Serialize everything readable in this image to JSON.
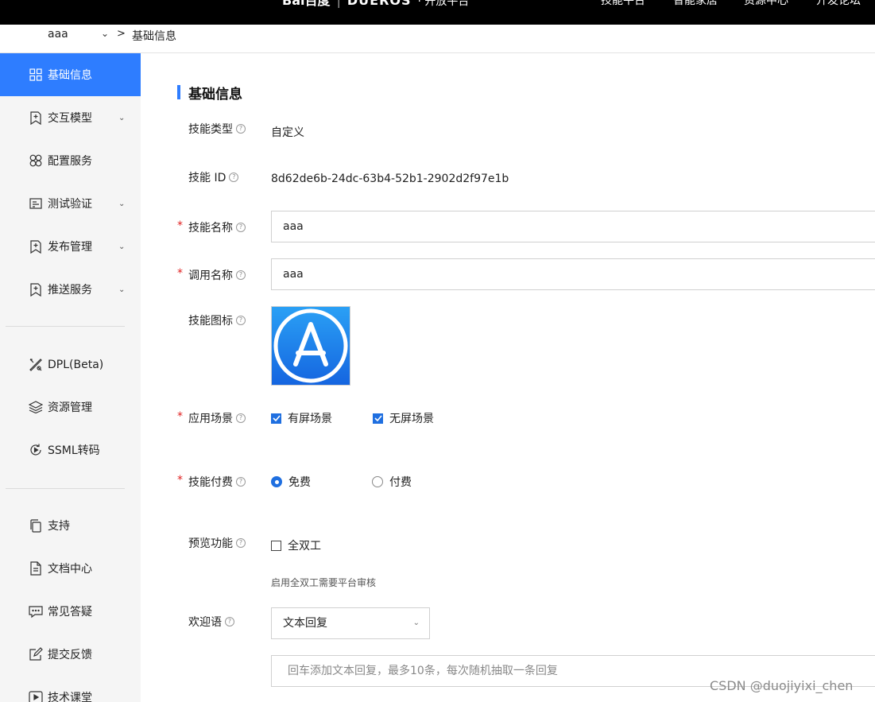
{
  "topbar": {
    "brand_logo": "Bai百度",
    "brand_os": "DUEROS",
    "brand_suffix": "· 开放平台",
    "nav": [
      "技能平台",
      "智能家居",
      "资源中心",
      "开发论坛"
    ]
  },
  "breadcrumb": {
    "skill_name": "aaa",
    "separator": ">",
    "current": "基础信息"
  },
  "sidebar": {
    "items": [
      {
        "label": "基础信息",
        "icon": "grid-icon",
        "active": true,
        "has_chevron": false
      },
      {
        "label": "交互模型",
        "icon": "bookmark-plus-icon",
        "active": false,
        "has_chevron": true
      },
      {
        "label": "配置服务",
        "icon": "clover-icon",
        "active": false,
        "has_chevron": false
      },
      {
        "label": "测试验证",
        "icon": "terminal-icon",
        "active": false,
        "has_chevron": true
      },
      {
        "label": "发布管理",
        "icon": "bookmark-plus-icon",
        "active": false,
        "has_chevron": true
      },
      {
        "label": "推送服务",
        "icon": "bookmark-plus-icon",
        "active": false,
        "has_chevron": true
      },
      {
        "label": "DPL(Beta)",
        "icon": "tools-icon",
        "active": false,
        "has_chevron": false
      },
      {
        "label": "资源管理",
        "icon": "layers-icon",
        "active": false,
        "has_chevron": false
      },
      {
        "label": "SSML转码",
        "icon": "refresh-play-icon",
        "active": false,
        "has_chevron": false
      },
      {
        "label": "支持",
        "icon": "copy-icon",
        "active": false,
        "has_chevron": false
      },
      {
        "label": "文档中心",
        "icon": "document-icon",
        "active": false,
        "has_chevron": false
      },
      {
        "label": "常见答疑",
        "icon": "chat-icon",
        "active": false,
        "has_chevron": false
      },
      {
        "label": "提交反馈",
        "icon": "edit-icon",
        "active": false,
        "has_chevron": false
      },
      {
        "label": "技术课堂",
        "icon": "video-icon",
        "active": false,
        "has_chevron": false
      }
    ]
  },
  "main": {
    "section_title": "基础信息",
    "skill_type": {
      "label": "技能类型",
      "value": "自定义"
    },
    "skill_id": {
      "label": "技能 ID",
      "value": "8d62de6b-24dc-63b4-52b1-2902d2f97e1b"
    },
    "skill_name": {
      "label": "技能名称",
      "value": "aaa",
      "required": "*"
    },
    "invoke_name": {
      "label": "调用名称",
      "value": "aaa",
      "required": "*"
    },
    "skill_icon": {
      "label": "技能图标"
    },
    "scenario": {
      "label": "应用场景",
      "required": "*",
      "options": [
        {
          "label": "有屏场景",
          "checked": true
        },
        {
          "label": "无屏场景",
          "checked": true
        }
      ]
    },
    "payment": {
      "label": "技能付费",
      "required": "*",
      "options": [
        {
          "label": "免费",
          "checked": true
        },
        {
          "label": "付费",
          "checked": false
        }
      ]
    },
    "preview": {
      "label": "预览功能",
      "option": {
        "label": "全双工",
        "checked": false
      },
      "hint": "启用全双工需要平台审核"
    },
    "welcome": {
      "label": "欢迎语",
      "select_value": "文本回复",
      "input_placeholder": "回车添加文本回复，最多10条，每次随机抽取一条回复"
    }
  },
  "watermark": "CSDN @duojiyixi_chen",
  "colors": {
    "primary": "#2e7dff",
    "required": "#e02020",
    "sidebar_bg": "#f5f5f5",
    "topbar_bg": "#000000"
  }
}
